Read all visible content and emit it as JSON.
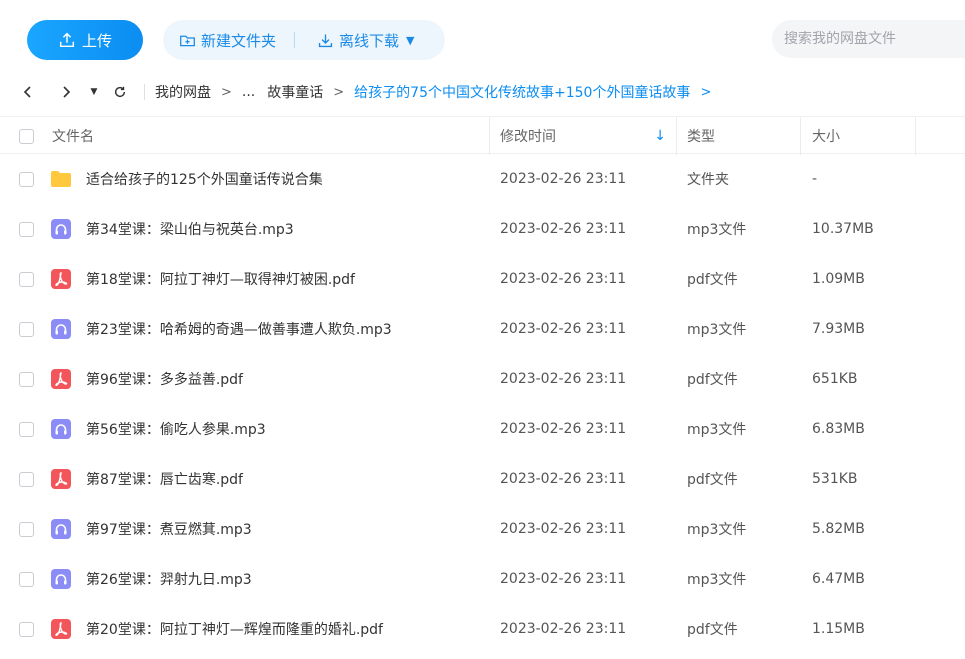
{
  "toolbar": {
    "upload_label": "上传",
    "new_folder_label": "新建文件夹",
    "offline_download_label": "离线下载",
    "search_placeholder": "搜索我的网盘文件"
  },
  "breadcrumb": {
    "items": [
      "我的网盘",
      "...",
      "故事童话",
      "给孩子的75个中国文化传统故事+150个外国童话故事"
    ]
  },
  "table": {
    "headers": {
      "name": "文件名",
      "modified": "修改时间",
      "type": "类型",
      "size": "大小"
    },
    "rows": [
      {
        "icon": "folder-icon",
        "name": "适合给孩子的125个外国童话传说合集",
        "modified": "2023-02-26 23:11",
        "type": "文件夹",
        "size": "-"
      },
      {
        "icon": "audio-file-icon",
        "name": "第34堂课：梁山伯与祝英台.mp3",
        "modified": "2023-02-26 23:11",
        "type": "mp3文件",
        "size": "10.37MB"
      },
      {
        "icon": "pdf-file-icon",
        "name": "第18堂课：阿拉丁神灯—取得神灯被困.pdf",
        "modified": "2023-02-26 23:11",
        "type": "pdf文件",
        "size": "1.09MB"
      },
      {
        "icon": "audio-file-icon",
        "name": "第23堂课：哈希姆的奇遇—做善事遭人欺负.mp3",
        "modified": "2023-02-26 23:11",
        "type": "mp3文件",
        "size": "7.93MB"
      },
      {
        "icon": "pdf-file-icon",
        "name": "第96堂课：多多益善.pdf",
        "modified": "2023-02-26 23:11",
        "type": "pdf文件",
        "size": "651KB"
      },
      {
        "icon": "audio-file-icon",
        "name": "第56堂课：偷吃人参果.mp3",
        "modified": "2023-02-26 23:11",
        "type": "mp3文件",
        "size": "6.83MB"
      },
      {
        "icon": "pdf-file-icon",
        "name": "第87堂课：唇亡齿寒.pdf",
        "modified": "2023-02-26 23:11",
        "type": "pdf文件",
        "size": "531KB"
      },
      {
        "icon": "audio-file-icon",
        "name": "第97堂课：煮豆燃萁.mp3",
        "modified": "2023-02-26 23:11",
        "type": "mp3文件",
        "size": "5.82MB"
      },
      {
        "icon": "audio-file-icon",
        "name": "第26堂课：羿射九日.mp3",
        "modified": "2023-02-26 23:11",
        "type": "mp3文件",
        "size": "6.47MB"
      },
      {
        "icon": "pdf-file-icon",
        "name": "第20堂课：阿拉丁神灯—辉煌而隆重的婚礼.pdf",
        "modified": "2023-02-26 23:11",
        "type": "pdf文件",
        "size": "1.15MB"
      }
    ]
  },
  "colors": {
    "accent": "#0b8df2",
    "folder": "#ffc83d",
    "audio": "#8b8cf5",
    "pdf": "#f2555a"
  }
}
